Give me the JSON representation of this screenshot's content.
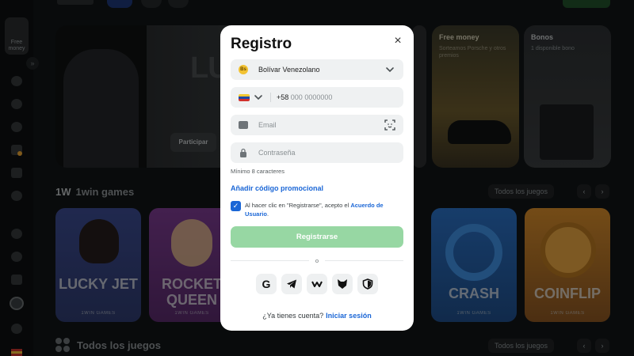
{
  "sidebar": {
    "free_label": "Free money"
  },
  "banners": {
    "main_text": "LU PO",
    "participate": "Participar",
    "free_money": {
      "title": "Free money",
      "subtitle": "Sorteamos Porsche y otros premios"
    },
    "bonos": {
      "title": "Bonos",
      "subtitle": "1 disponible bono"
    }
  },
  "sections": {
    "games": {
      "logo": "1W",
      "title": "1win games",
      "all_label": "Todos los juegos"
    },
    "all_games": {
      "title": "Todos los juegos",
      "all_label": "Todos los juegos"
    }
  },
  "cards": [
    {
      "name": "LUCKY JET",
      "provider": "1WIN GAMES"
    },
    {
      "name": "ROCKET QUEEN",
      "provider": "1WIN GAMES"
    },
    {
      "name": "CRASH",
      "provider": "1WIN GAMES"
    },
    {
      "name": "COINFLIP",
      "provider": "1WIN GAMES"
    }
  ],
  "modal": {
    "title": "Registro",
    "close": "×",
    "currency": "Bolívar Venezolano",
    "currency_symbol": "Bs",
    "phone_code": "+58",
    "phone_placeholder": "000 0000000",
    "email_placeholder": "Email",
    "password_placeholder": "Contraseña",
    "password_hint": "Mínimo 8 caracteres",
    "promo_link": "Añadir código promocional",
    "terms_text": "Al hacer clic en \"Registrarse\", acepto el ",
    "terms_link": "Acuerdo de Usuario",
    "terms_end": ".",
    "register_button": "Registrarse",
    "divider_text": "o",
    "account_question": "¿Ya tienes cuenta?",
    "login_link": "Iniciar sesión"
  },
  "social_icons": [
    "google-icon",
    "telegram-icon",
    "worldcoin-icon",
    "steam-icon",
    "shield-icon"
  ],
  "colors": {
    "accent_blue": "#1a66d6",
    "register_green": "#97d7a3",
    "checkbox": "#1a66d6"
  }
}
